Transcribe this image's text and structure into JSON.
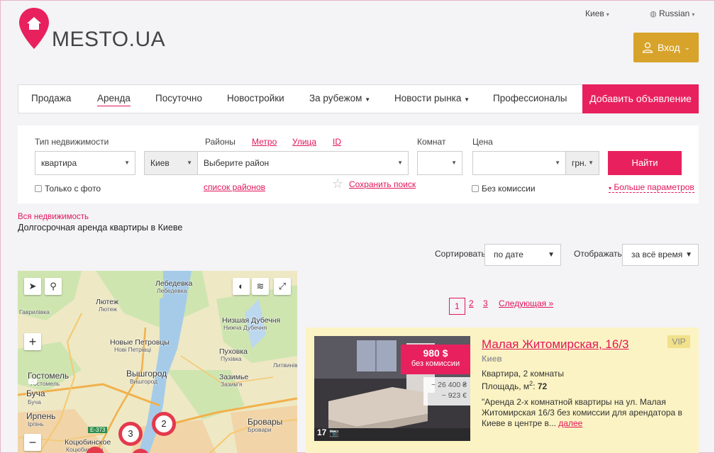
{
  "header": {
    "logo_text": "MESTO.UA",
    "city": "Киев",
    "language": "Russian",
    "login": "Вход"
  },
  "nav": {
    "items": [
      "Продажа",
      "Аренда",
      "Посуточно",
      "Новостройки",
      "За рубежом",
      "Новости рынка",
      "Профессионалы"
    ],
    "add_button": "Добавить объявление"
  },
  "search": {
    "type_label": "Тип недвижимости",
    "type_value": "квартира",
    "city_value": "Киев",
    "districts_label": "Районы",
    "metro_link": "Метро",
    "street_link": "Улица",
    "id_link": "ID",
    "district_placeholder": "Выберите район",
    "rooms_label": "Комнат",
    "price_label": "Цена",
    "currency": "грн.",
    "find_button": "Найти",
    "only_photo": "Только с фото",
    "district_list": "список районов",
    "save_search": "Сохранить поиск",
    "no_commission": "Без комиссии",
    "more_params": "Больше параметров"
  },
  "breadcrumb": "Вся недвижимость",
  "subtitle": "Долгосрочная аренда квартиры в Киеве",
  "sorting": {
    "sort_label": "Сортировать",
    "sort_value": "по дате",
    "show_label": "Отображать",
    "show_value": "за всё время"
  },
  "map": {
    "labels": [
      "Лебедевка",
      "Лютеж",
      "Новые Петровцы",
      "Низшая Дубечня",
      "Пуховка",
      "Гостомель",
      "Вышгород",
      "Зазимье",
      "Буча",
      "Ирпень",
      "Коцюбинское",
      "Бровары"
    ],
    "small_labels": [
      "Лебедевка",
      "Лютеж",
      "Гаврилівка",
      "Нові Петрівці",
      "Нижча Дубечня",
      "Пухівка",
      "Гостомель",
      "Вишгород",
      "Зазим'я",
      "Буча",
      "Ірпінь",
      "Коцюбинське",
      "Бровари",
      "Литвинівка"
    ],
    "road": "E-373",
    "markers": [
      "3",
      "2"
    ]
  },
  "pagination": {
    "pages": [
      "1",
      "2",
      "3"
    ],
    "next": "Следующая »"
  },
  "listing": {
    "title": "Малая Житомирская, 16/3",
    "vip": "VIP",
    "city": "Киев",
    "price": "980 $",
    "price_note": "без комиссии",
    "alt_price_1": "~ 26 400 ₴",
    "alt_price_2": "~ 923 €",
    "photo_count": "17",
    "rooms": "Квартира, 2 комнаты",
    "area_label": "Площадь, м",
    "area_sup": "2",
    "area_value": "72",
    "desc": "\"Аренда 2-х комнатной квартиры на ул. Малая Житомирская 16/3 без комиссии для арендатора в Киеве в центре в...",
    "more": "далее"
  }
}
